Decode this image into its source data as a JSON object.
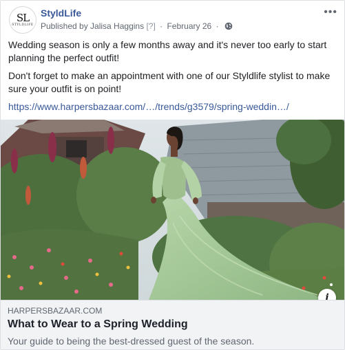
{
  "post": {
    "page_name": "StyldLife",
    "avatar_monogram": "SL",
    "avatar_wordmark": "STYLDLIFE",
    "published_by": "Published by Jalisa Haggins",
    "help_marker": "[?]",
    "separator": "·",
    "date": "February 26",
    "privacy_icon": "globe-icon",
    "more_label": "•••",
    "body": {
      "paragraph_1": "Wedding season is only a few months away and it's never too early to start planning the perfect outfit!",
      "paragraph_2": "Don't forget to make an appointment with one of our Styldlife stylist to make sure your outfit is on point!",
      "link_text": "https://www.harpersbazaar.com/…/trends/g3579/spring-weddin…/"
    },
    "link_preview": {
      "domain": "HARPERSBAZAAR.COM",
      "title": "What to Wear to a Spring Wedding",
      "description": "Your guide to being the best-dressed guest of the season.",
      "info_label": "i"
    }
  },
  "colors": {
    "link_blue": "#385898",
    "meta_gray": "#606770",
    "preview_bg": "#f2f3f5",
    "dress_green": "#a7c99a"
  }
}
